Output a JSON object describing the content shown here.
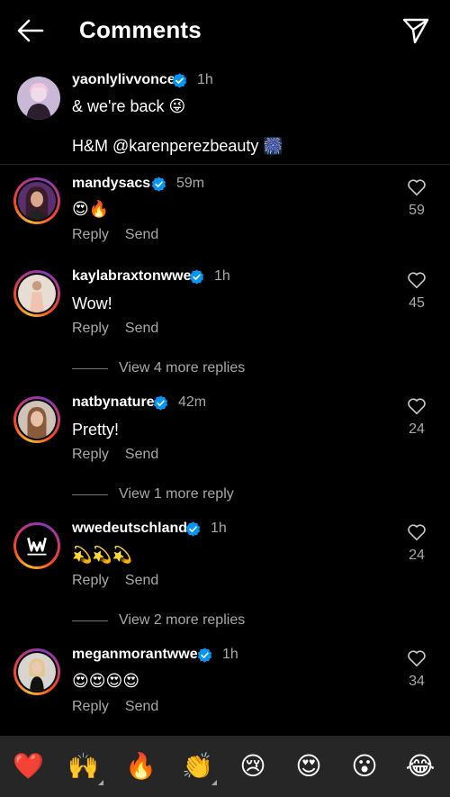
{
  "header": {
    "title": "Comments"
  },
  "caption": {
    "username": "yaonlylivvonce",
    "time": "1h",
    "line1": "& we're back 😜",
    "line2": "H&M @karenperezbeauty 🎆"
  },
  "comments": [
    {
      "username": "mandysacs",
      "time": "59m",
      "text": "😍🔥",
      "likes": "59",
      "reply": "Reply",
      "send": "Send"
    },
    {
      "username": "kaylabraxtonwwe",
      "time": "1h",
      "text": "Wow!",
      "likes": "45",
      "reply": "Reply",
      "send": "Send",
      "more": "View 4 more replies"
    },
    {
      "username": "natbynature",
      "time": "42m",
      "text": "Pretty!",
      "likes": "24",
      "reply": "Reply",
      "send": "Send",
      "more": "View 1 more reply"
    },
    {
      "username": "wwedeutschland",
      "time": "1h",
      "text": "💫💫💫",
      "likes": "24",
      "reply": "Reply",
      "send": "Send",
      "more": "View 2 more replies"
    },
    {
      "username": "meganmorantwwe",
      "time": "1h",
      "text": "😍😍😍😍",
      "likes": "34",
      "reply": "Reply",
      "send": "Send"
    }
  ],
  "emoji_bar": [
    "❤️",
    "🙌",
    "🔥",
    "👏",
    "😢",
    "😍",
    "😮",
    "😂"
  ],
  "colors": {
    "background": "#000000",
    "secondary_text": "#a8a8a8",
    "verified": "#0095f6",
    "emoji_bar_bg": "#262626"
  }
}
